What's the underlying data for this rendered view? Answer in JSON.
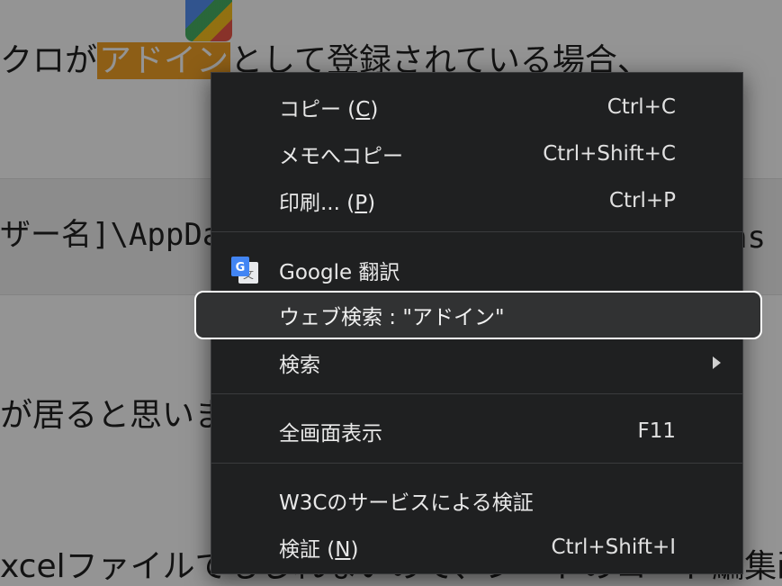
{
  "background": {
    "line1_prefix": "クロが",
    "line1_highlight": "アドイン",
    "line1_suffix": "として登録されている場合、",
    "line2": "ザー名]\\AppDa",
    "line2_tail": "ns",
    "line3": "が居ると思いま",
    "line4": "xcelファイルでもしれないので、シートのコード編集画"
  },
  "menu": {
    "copy": {
      "label_prefix": "コピー (",
      "label_accel": "C",
      "label_suffix": ")",
      "shortcut": "Ctrl+C"
    },
    "copy_to_notes": {
      "label": "メモへコピー",
      "shortcut": "Ctrl+Shift+C"
    },
    "print": {
      "label_prefix": "印刷... (",
      "label_accel": "P",
      "label_suffix": ")",
      "shortcut": "Ctrl+P"
    },
    "google_translate": {
      "label": "Google 翻訳",
      "icon": "google-translate-icon"
    },
    "web_search": {
      "label": "ウェブ検索 : \"アドイン\""
    },
    "search": {
      "label": "検索",
      "icon": "chevron-right-icon"
    },
    "fullscreen": {
      "label": "全画面表示",
      "shortcut": "F11"
    },
    "w3c_validate": {
      "label": "W3Cのサービスによる検証"
    },
    "inspect": {
      "label_prefix": "検証 (",
      "label_accel": "N",
      "label_suffix": ")",
      "shortcut": "Ctrl+Shift+I"
    }
  },
  "colors": {
    "menu_bg": "#1f2021",
    "highlight_bg": "#313233",
    "selection": "#f3a326"
  }
}
